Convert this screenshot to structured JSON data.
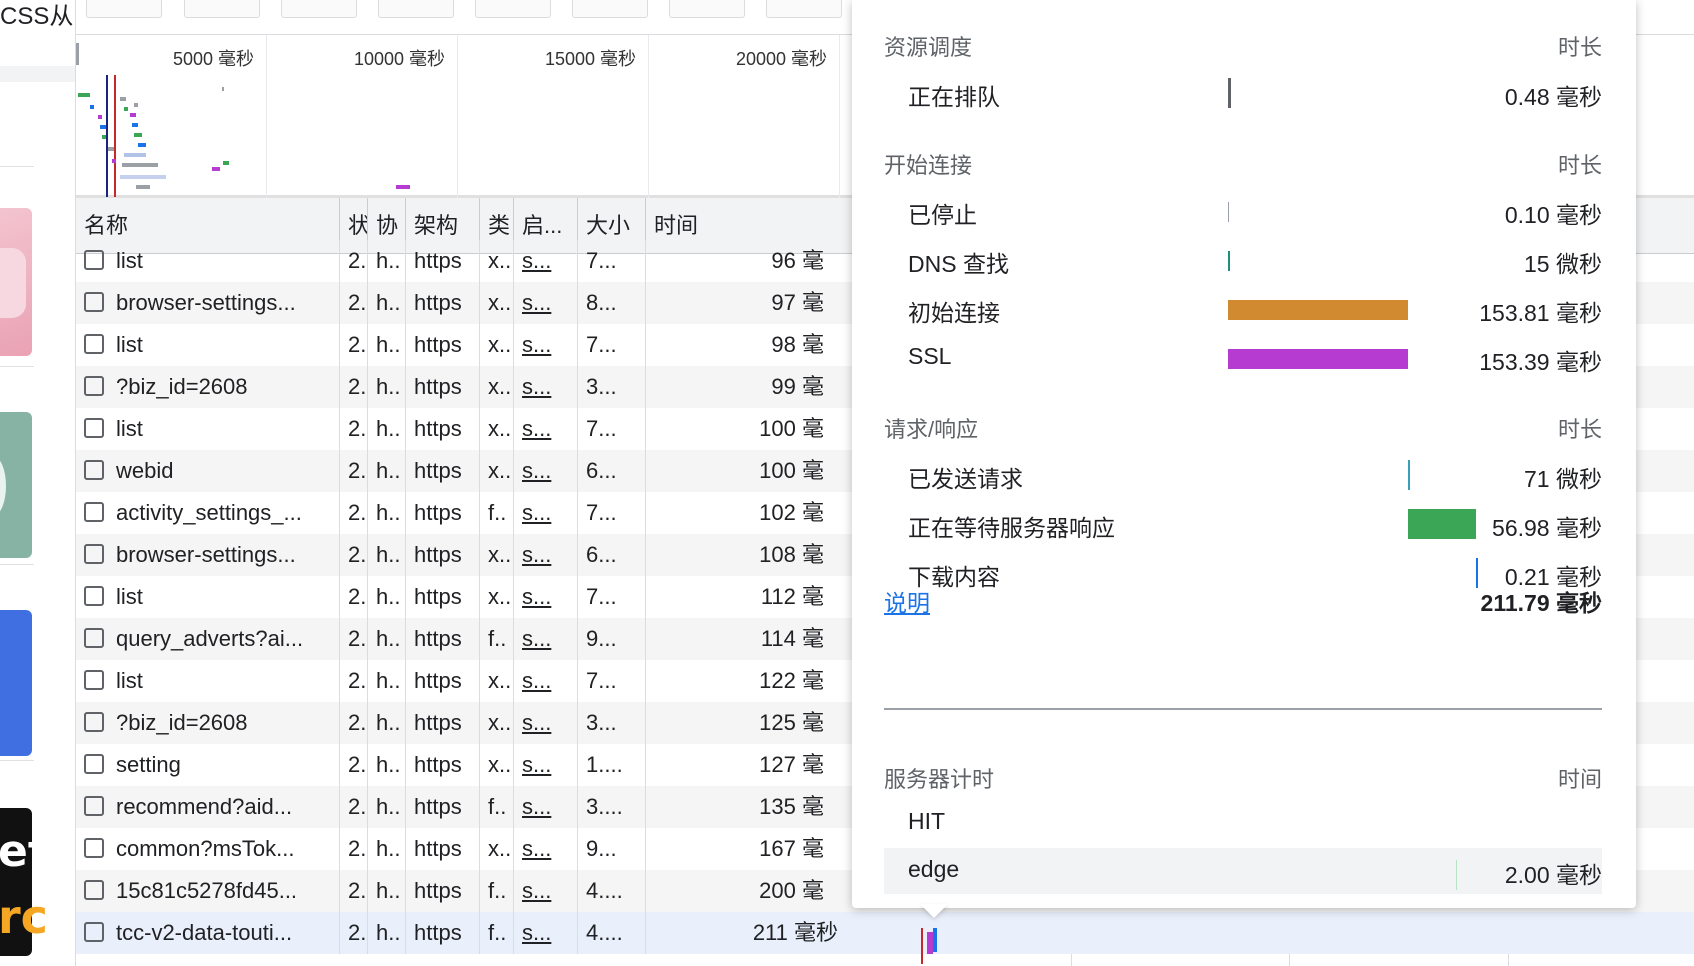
{
  "left_panel": {
    "title": "CSS从",
    "thumb_black_line1": "et",
    "thumb_black_line2": "rc"
  },
  "overview": {
    "ticks": [
      "5000 毫秒",
      "10000 毫秒",
      "15000 毫秒",
      "20000 毫秒"
    ]
  },
  "columns": [
    "名称",
    "状",
    "协",
    "架构",
    "类",
    "启...",
    "大小",
    "时间"
  ],
  "rows": [
    {
      "name": "list",
      "status": "2.",
      "proto": "h..",
      "scheme": "https",
      "type": "x..",
      "initiator": "s...",
      "size": "7...",
      "time": "96 毫"
    },
    {
      "name": "browser-settings...",
      "status": "2.",
      "proto": "h..",
      "scheme": "https",
      "type": "x..",
      "initiator": "s...",
      "size": "8...",
      "time": "97 毫"
    },
    {
      "name": "list",
      "status": "2.",
      "proto": "h..",
      "scheme": "https",
      "type": "x..",
      "initiator": "s...",
      "size": "7...",
      "time": "98 毫"
    },
    {
      "name": "?biz_id=2608",
      "status": "2.",
      "proto": "h..",
      "scheme": "https",
      "type": "x..",
      "initiator": "s...",
      "size": "3...",
      "time": "99 毫"
    },
    {
      "name": "list",
      "status": "2.",
      "proto": "h..",
      "scheme": "https",
      "type": "x..",
      "initiator": "s...",
      "size": "7...",
      "time": "100 毫"
    },
    {
      "name": "webid",
      "status": "2.",
      "proto": "h..",
      "scheme": "https",
      "type": "x..",
      "initiator": "s...",
      "size": "6...",
      "time": "100 毫"
    },
    {
      "name": "activity_settings_...",
      "status": "2.",
      "proto": "h..",
      "scheme": "https",
      "type": "f..",
      "initiator": "s...",
      "size": "7...",
      "time": "102 毫"
    },
    {
      "name": "browser-settings...",
      "status": "2.",
      "proto": "h..",
      "scheme": "https",
      "type": "x..",
      "initiator": "s...",
      "size": "6...",
      "time": "108 毫"
    },
    {
      "name": "list",
      "status": "2.",
      "proto": "h..",
      "scheme": "https",
      "type": "x..",
      "initiator": "s...",
      "size": "7...",
      "time": "112 毫"
    },
    {
      "name": "query_adverts?ai...",
      "status": "2.",
      "proto": "h..",
      "scheme": "https",
      "type": "f..",
      "initiator": "s...",
      "size": "9...",
      "time": "114 毫"
    },
    {
      "name": "list",
      "status": "2.",
      "proto": "h..",
      "scheme": "https",
      "type": "x..",
      "initiator": "s...",
      "size": "7...",
      "time": "122 毫"
    },
    {
      "name": "?biz_id=2608",
      "status": "2.",
      "proto": "h..",
      "scheme": "https",
      "type": "x..",
      "initiator": "s...",
      "size": "3...",
      "time": "125 毫"
    },
    {
      "name": "setting",
      "status": "2.",
      "proto": "h..",
      "scheme": "https",
      "type": "x..",
      "initiator": "s...",
      "size": "1....",
      "time": "127 毫"
    },
    {
      "name": "recommend?aid...",
      "status": "2.",
      "proto": "h..",
      "scheme": "https",
      "type": "f..",
      "initiator": "s...",
      "size": "3....",
      "time": "135 毫"
    },
    {
      "name": "common?msTok...",
      "status": "2.",
      "proto": "h..",
      "scheme": "https",
      "type": "x..",
      "initiator": "s...",
      "size": "9...",
      "time": "167 毫"
    },
    {
      "name": "15c81c5278fd45...",
      "status": "2.",
      "proto": "h..",
      "scheme": "https",
      "type": "f..",
      "initiator": "s...",
      "size": "4....",
      "time": "200 毫"
    },
    {
      "name": "tcc-v2-data-touti...",
      "status": "2.",
      "proto": "h..",
      "scheme": "https",
      "type": "f..",
      "initiator": "s...",
      "size": "4....",
      "time": "211 毫秒"
    }
  ],
  "timing": {
    "sections": [
      {
        "title": "资源调度",
        "right": "时长",
        "items": [
          {
            "label": "正在排队",
            "value": "0.48 毫秒",
            "color": "#5f6368"
          }
        ]
      },
      {
        "title": "开始连接",
        "right": "时长",
        "items": [
          {
            "label": "已停止",
            "value": "0.10 毫秒",
            "color": "#9aa0a6"
          },
          {
            "label": "DNS 查找",
            "value": "15 微秒",
            "color": "#1e8e7e"
          },
          {
            "label": "初始连接",
            "value": "153.81 毫秒",
            "color": "#d18a2f"
          },
          {
            "label": "SSL",
            "value": "153.39 毫秒",
            "color": "#b63cd1"
          }
        ]
      },
      {
        "title": "请求/响应",
        "right": "时长",
        "items": [
          {
            "label": "已发送请求",
            "value": "71 微秒",
            "color": "#3aa0b8"
          },
          {
            "label": "正在等待服务器响应",
            "value": "56.98 毫秒",
            "color": "#3ba655"
          },
          {
            "label": "下载内容",
            "value": "0.21 毫秒",
            "color": "#1a73e8"
          }
        ]
      }
    ],
    "explain_link": "说明",
    "total": "211.79 毫秒",
    "server_timing": {
      "title": "服务器计时",
      "right": "时间",
      "items": [
        {
          "label": "HIT",
          "value": ""
        },
        {
          "label": "edge",
          "value": "2.00 毫秒"
        }
      ]
    }
  }
}
